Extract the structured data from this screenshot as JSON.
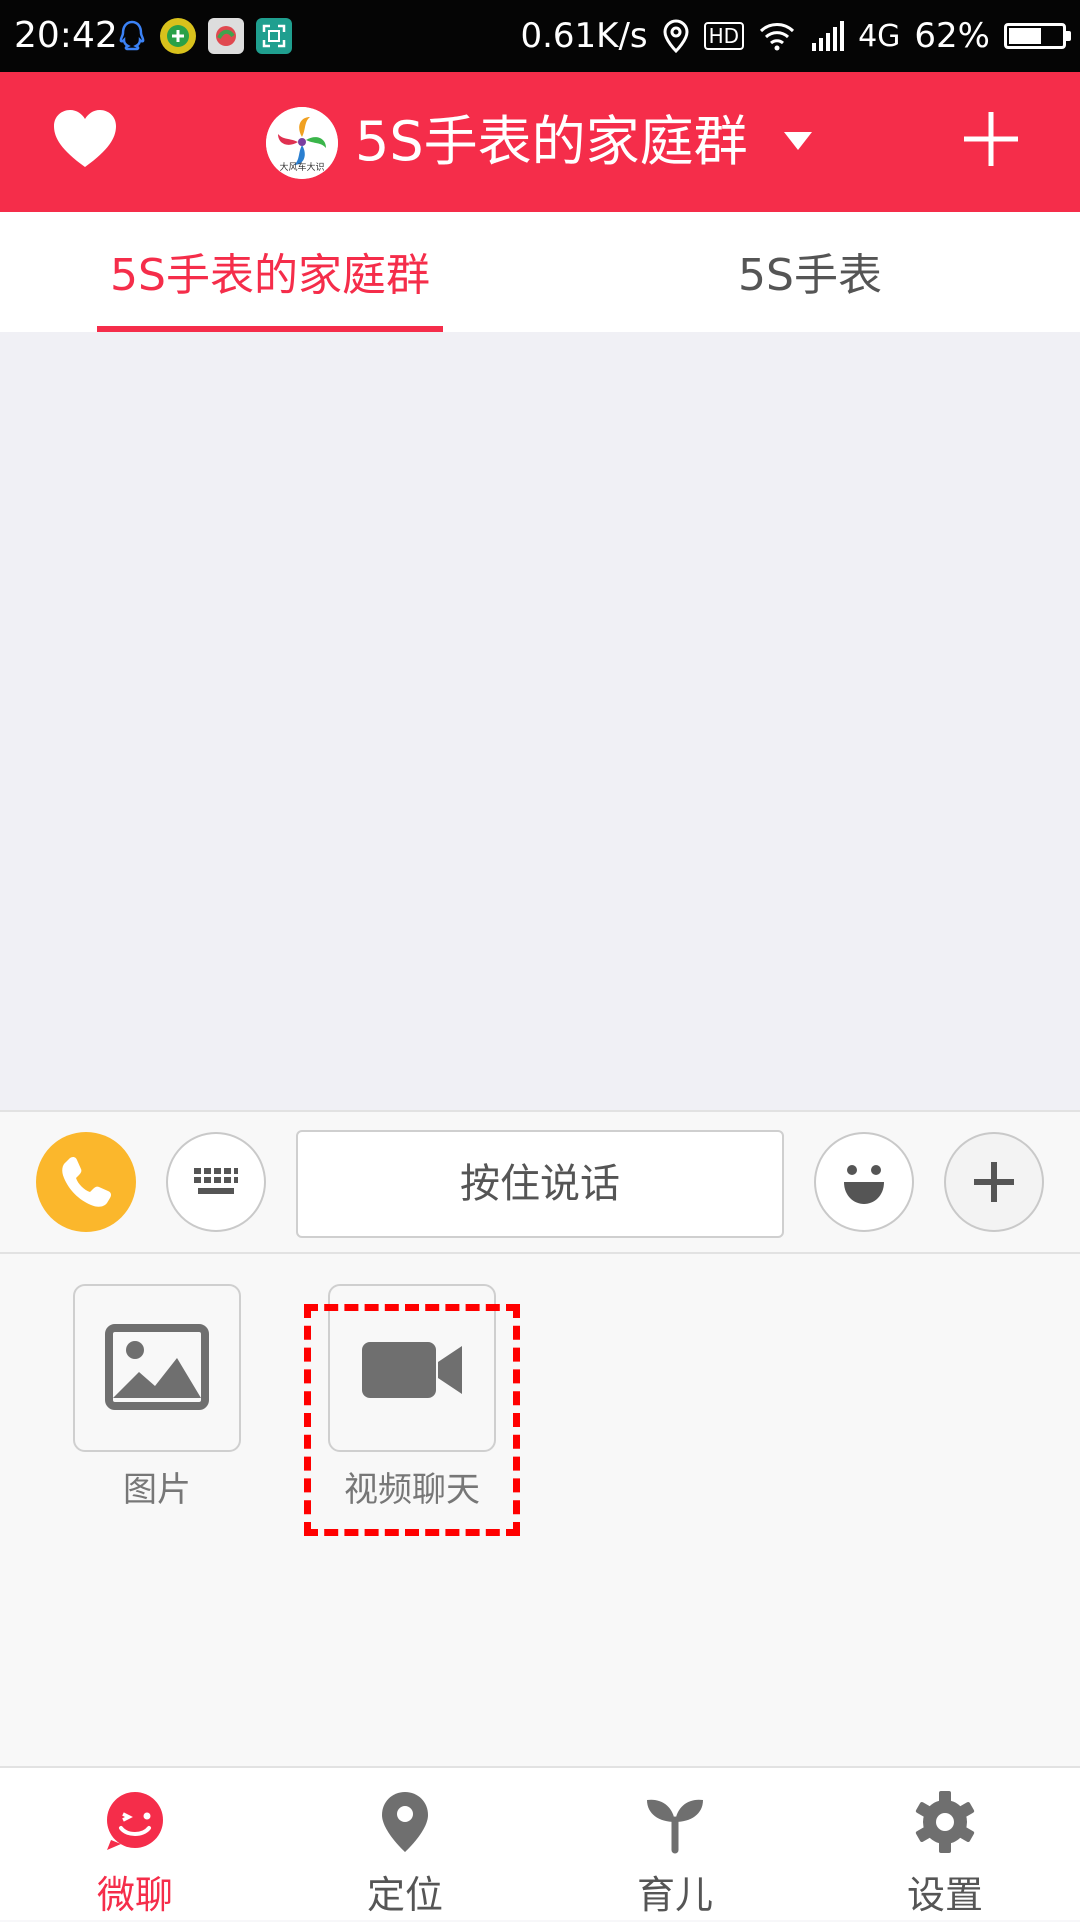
{
  "status_bar": {
    "time": "20:42",
    "net_speed": "0.61K/s",
    "hd": "HD",
    "network": "4G",
    "battery_text": "62%",
    "battery_level": 0.62
  },
  "header": {
    "group_title": "5S手表的家庭群",
    "avatar_text": "大风车大识"
  },
  "tabs": [
    {
      "label": "5S手表的家庭群"
    },
    {
      "label": "5S手表"
    }
  ],
  "input_bar": {
    "voice_label": "按住说话"
  },
  "panel": {
    "items": [
      {
        "label": "图片"
      },
      {
        "label": "视频聊天"
      }
    ]
  },
  "bottom_nav": [
    {
      "label": "微聊"
    },
    {
      "label": "定位"
    },
    {
      "label": "育儿"
    },
    {
      "label": "设置"
    }
  ],
  "colors": {
    "brand": "#f52d4a",
    "call_button": "#fbb72c",
    "highlight": "#ff0000",
    "icon_grey": "#6f6f6f"
  }
}
